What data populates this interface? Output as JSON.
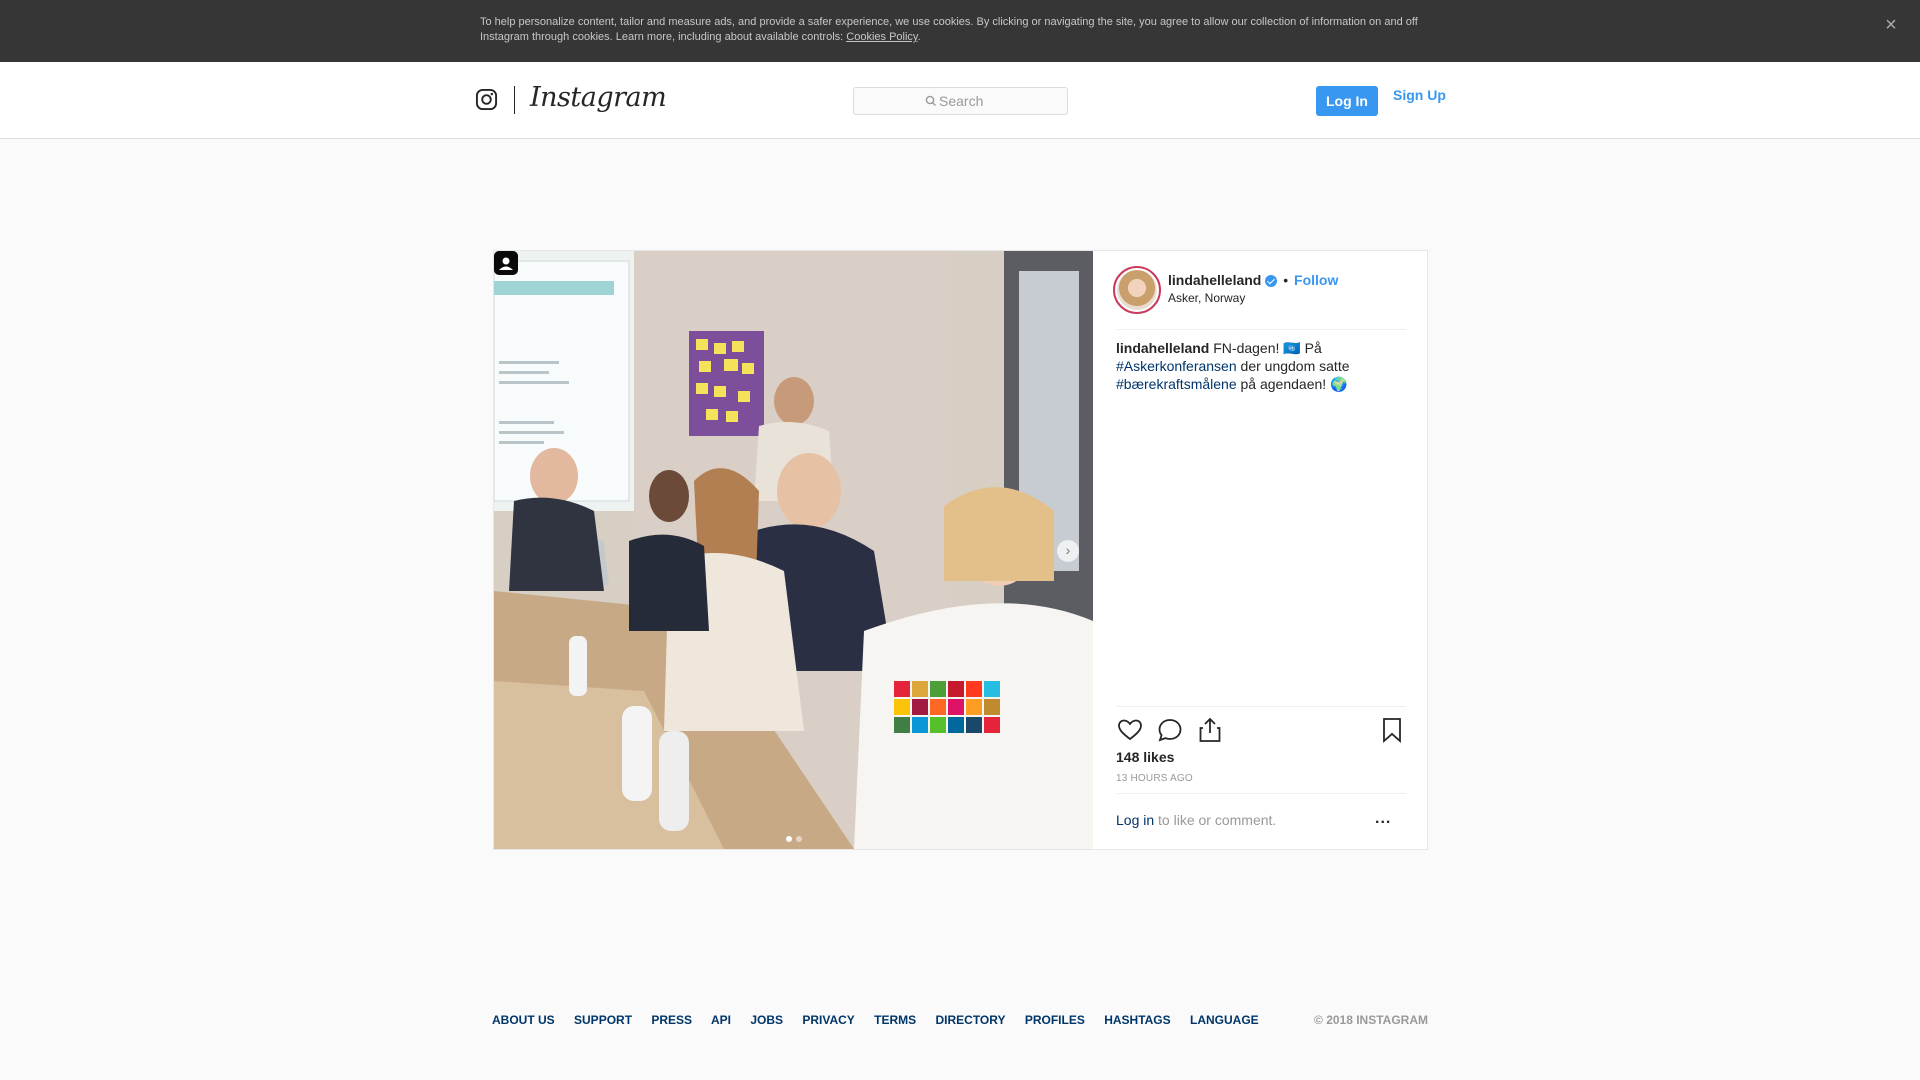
{
  "cookie_banner": {
    "text": "To help personalize content, tailor and measure ads, and provide a safer experience, we use cookies. By clicking or navigating the site, you agree to allow our collection of information on and off Instagram through cookies. Learn more, including about available controls: ",
    "link": "Cookies Policy",
    "close_icon": "close-icon"
  },
  "header": {
    "brand": "Instagram",
    "search_placeholder": "Search",
    "login_label": "Log In",
    "signup_label": "Sign Up"
  },
  "post": {
    "username": "lindahelleland",
    "verified": true,
    "bullet": "•",
    "follow_label": "Follow",
    "location": "Asker, Norway",
    "caption": {
      "author": "lindahelleland",
      "part1": " FN-dagen! 🇺🇳 På ",
      "hashtag1": "#Askerkonferansen",
      "part2": " der ungdom satte ",
      "hashtag2": "#bærekraftsmålene",
      "part3": " på agendaen! 🌍"
    },
    "likes": "148 likes",
    "time": "13 HOURS AGO",
    "login_link": "Log in",
    "login_suffix": " to like or comment.",
    "more_label": "..."
  },
  "footer": {
    "links": [
      "ABOUT US",
      "SUPPORT",
      "PRESS",
      "API",
      "JOBS",
      "PRIVACY",
      "TERMS",
      "DIRECTORY",
      "PROFILES",
      "HASHTAGS",
      "LANGUAGE"
    ],
    "copyright": "© 2018 INSTAGRAM"
  },
  "colors": {
    "accent": "#3897f0",
    "link_dark": "#003569",
    "banner": "#363636"
  }
}
